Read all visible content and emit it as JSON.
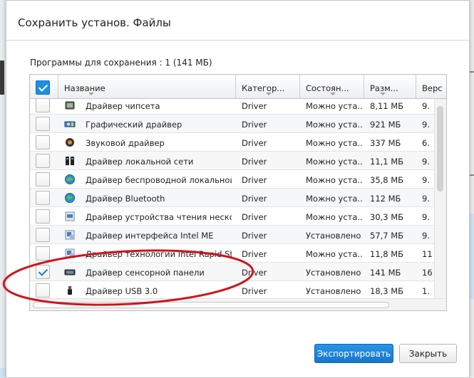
{
  "dialog": {
    "title": "Сохранить установ. Файлы",
    "summary": "Программы для сохранения : 1 (141 МБ)"
  },
  "table": {
    "columns": [
      "Название",
      "Категор...",
      "Состоян...",
      "Разм...",
      "Верс"
    ],
    "select_all_checked": true,
    "rows": [
      {
        "name": "Драйвер чипсета",
        "category": "Driver",
        "state": "Можно уста...",
        "size": "8,11 МБ",
        "version": "9.",
        "checked": false,
        "icon": "chip-icon"
      },
      {
        "name": "Графический драйвер",
        "category": "Driver",
        "state": "Можно уста...",
        "size": "921 МБ",
        "version": "9.",
        "checked": false,
        "icon": "graphics-card-icon"
      },
      {
        "name": "Звуковой драйвер",
        "category": "Driver",
        "state": "Можно уста...",
        "size": "337 МБ",
        "version": "6.",
        "checked": false,
        "icon": "speaker-icon"
      },
      {
        "name": "Драйвер локальной сети",
        "category": "Driver",
        "state": "Можно уста...",
        "size": "11,1 МБ",
        "version": "9.",
        "checked": false,
        "icon": "network-icon"
      },
      {
        "name": "Драйвер  беспроводной  локальной...",
        "category": "Driver",
        "state": "Можно уста...",
        "size": "35,8 МБ",
        "version": "9.",
        "checked": false,
        "icon": "wireless-globe-icon"
      },
      {
        "name": "Драйвер Bluetooth",
        "category": "Driver",
        "state": "Можно уста...",
        "size": "112 МБ",
        "version": "9.",
        "checked": false,
        "icon": "bluetooth-globe-icon"
      },
      {
        "name": "Драйвер устройства чтения  нескол...",
        "category": "Driver",
        "state": "Можно уста...",
        "size": "30,3 МБ",
        "version": "9.",
        "checked": false,
        "icon": "card-reader-icon"
      },
      {
        "name": "Драйвер интерфейса Intel ME",
        "category": "Driver",
        "state": "Установлено",
        "size": "57,7 МБ",
        "version": "9.",
        "checked": false,
        "icon": "installer-icon"
      },
      {
        "name": "Драйвер технологии Intel Rapid St...",
        "category": "Driver",
        "state": "Можно уста...",
        "size": "11,8 МБ",
        "version": "11",
        "checked": false,
        "icon": "installer-icon"
      },
      {
        "name": "Драйвер сенсорной панели",
        "category": "Driver",
        "state": "Установлено",
        "size": "141 МБ",
        "version": "16",
        "checked": true,
        "icon": "touchpad-icon"
      },
      {
        "name": "Драйвер USB 3.0",
        "category": "Driver",
        "state": "Установлено",
        "size": "18,3 МБ",
        "version": "1.",
        "checked": false,
        "icon": "usb-icon"
      }
    ]
  },
  "buttons": {
    "export": "Экспортировать",
    "close": "Закрыть"
  },
  "colors": {
    "accent": "#1e8fe0",
    "annotation": "#d0141c"
  }
}
